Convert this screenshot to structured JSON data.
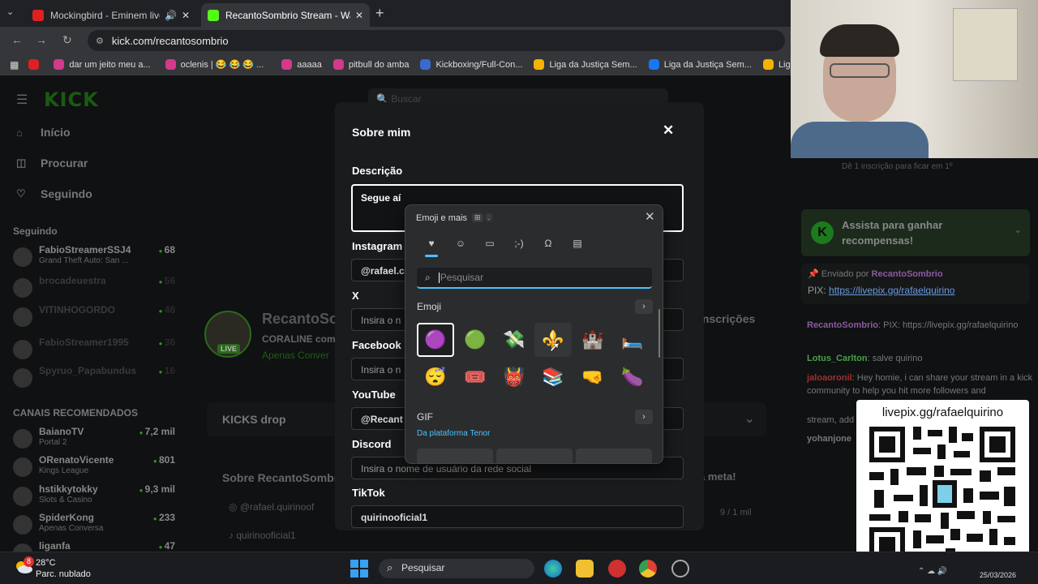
{
  "browser": {
    "tabs": [
      {
        "title": "Mockingbird - Eminem live",
        "active": false
      },
      {
        "title": "RecantoSombrio Stream - Watc",
        "active": true
      }
    ],
    "url": "kick.com/recantosombrio",
    "bookmarks": [
      "dar um jeito meu a...",
      "oclenis | 😂 😂 😂 ...",
      "aaaaa",
      "pitbull do amba",
      "Kickboxing/Full-Con...",
      "Liga da Justiça Sem...",
      "Liga da Justiça Sem...",
      "Liga"
    ]
  },
  "kick": {
    "search_placeholder": "Buscar",
    "nav": [
      "Início",
      "Procurar",
      "Seguindo"
    ],
    "following_header": "Seguindo",
    "following": [
      {
        "name": "FabioStreamerSSJ4",
        "game": "Grand Theft Auto: San ...",
        "viewers": "68"
      },
      {
        "name": "brocadeuestra",
        "game": "",
        "viewers": "56"
      },
      {
        "name": "VITINHOGORDO",
        "game": "",
        "viewers": "46"
      },
      {
        "name": "FabioStreamer1995",
        "game": "",
        "viewers": "36"
      },
      {
        "name": "Spyruo_Papabundus",
        "game": "",
        "viewers": "16"
      }
    ],
    "recommended_header": "CANAIS RECOMENDADOS",
    "recommended": [
      {
        "name": "BaianoTV",
        "game": "Portal 2",
        "viewers": "7,2 mil"
      },
      {
        "name": "ORenatoVicente",
        "game": "Kings League",
        "viewers": "801"
      },
      {
        "name": "hstikkytokky",
        "game": "Slots & Casino",
        "viewers": "9,3 mil"
      },
      {
        "name": "SpiderKong",
        "game": "Apenas Conversa",
        "viewers": "233"
      },
      {
        "name": "liganfa",
        "game": "",
        "viewers": "47"
      }
    ],
    "streamer": "RecantoSo",
    "stream_title": "CORALINE com",
    "category": "Apenas Conver",
    "live": "LIVE",
    "kicks_drop": "KICKS drop",
    "about": "Sobre RecantoSombrio",
    "social_instagram": "@rafael.quirinoof",
    "social_tiktok": "quirinooficial1",
    "subs_label": "inscrições",
    "meta_label": "a meta!",
    "meta_count": "9 / 1 mil"
  },
  "modal": {
    "title": "Sobre mim",
    "description_label": "Descrição",
    "description_value": "Segue aí",
    "instagram_label": "Instagram",
    "instagram_value": "@rafael.c",
    "x_label": "X",
    "x_placeholder": "Insira o n",
    "facebook_label": "Facebook",
    "facebook_placeholder": "Insira o n",
    "youtube_label": "YouTube",
    "youtube_value": "@Recant",
    "discord_label": "Discord",
    "discord_placeholder": "Insira o nome de usuário da rede social",
    "tiktok_label": "TikTok",
    "tiktok_value": "quirinooficial1"
  },
  "emoji_panel": {
    "title": "Emoji e mais",
    "search_placeholder": "Pesquisar",
    "section_emoji": "Emoji",
    "section_gif": "GIF",
    "gif_source": "Da plataforma Tenor",
    "emojis_row1": [
      "🟣",
      "🟢",
      "💸",
      "⚜️",
      "🏰",
      "🛏️"
    ],
    "emojis_row2": [
      "😴",
      "🎟️",
      "👹",
      "📚",
      "🤜",
      "🍆"
    ]
  },
  "chat": {
    "sub_hint": "Dê 1 inscrição para ficar em 1º",
    "watch_reward": "Assista para ganhar recompensas!",
    "pinned_by": "Enviado por",
    "pinned_user": "RecantoSombrio",
    "pinned_text": "PIX:",
    "pinned_link": "https://livepix.gg/rafaelquirino",
    "messages": [
      {
        "user": "RecantoSombrio",
        "text": "PIX: https://livepix.gg/rafaelquirino"
      },
      {
        "user": "Lotus_Carlton",
        "text": "salve quirino"
      },
      {
        "user": "jaloaoronil",
        "text": "Hey homie, i can share your stream in a kick community to help you hit more followers and"
      },
      {
        "user": "",
        "text": "stream, add"
      },
      {
        "user": "yohanjone",
        "text": ""
      }
    ],
    "qr_title": "livepix.gg/rafaelquirino"
  },
  "taskbar": {
    "temp": "28°C",
    "weather": "Parc. nublado",
    "badge": "8",
    "search": "Pesquisar",
    "date": "25/03/2026"
  }
}
